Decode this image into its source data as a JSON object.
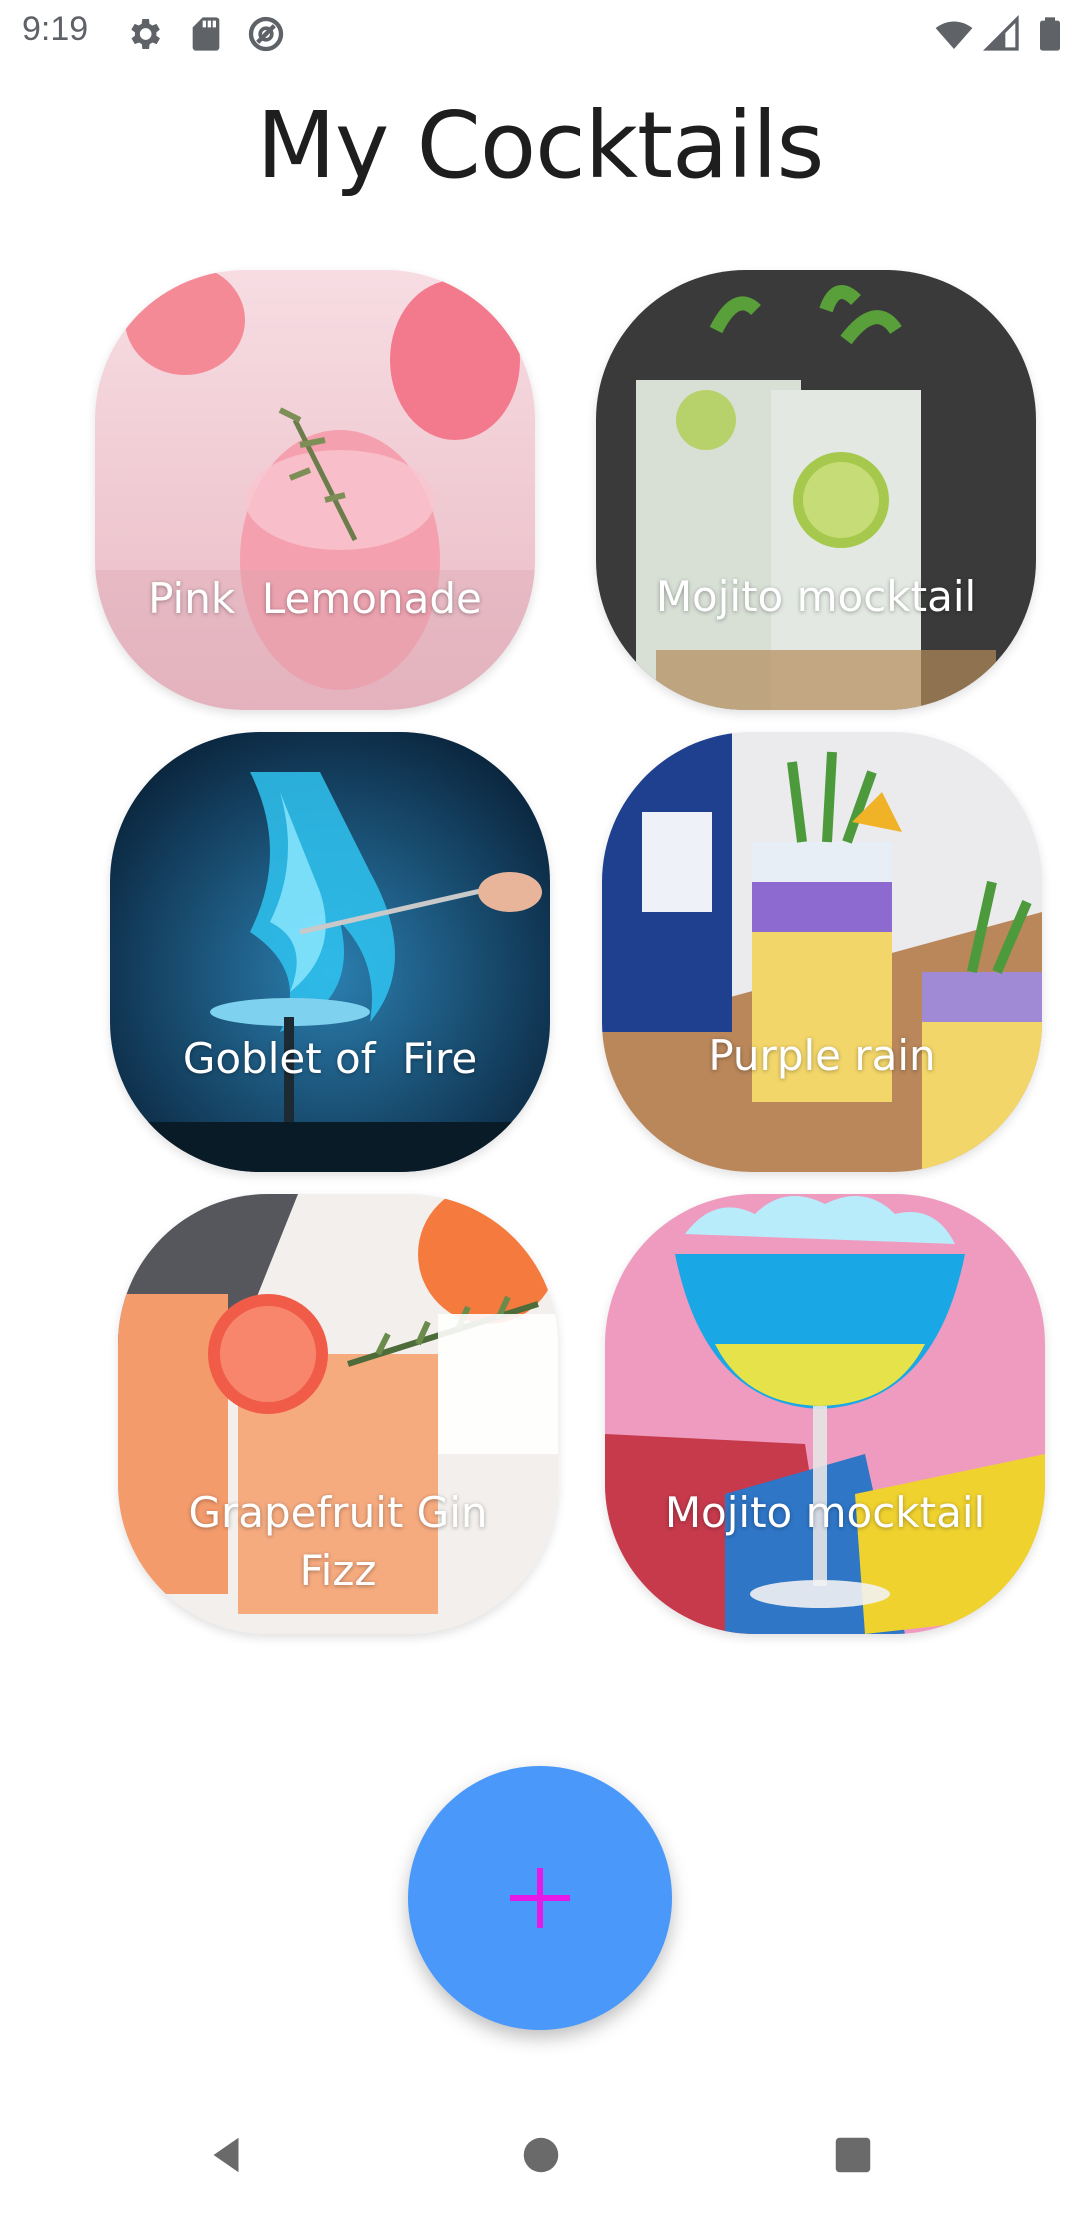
{
  "status_bar": {
    "time": "9:19",
    "icons": [
      "settings-icon",
      "sd-card-icon",
      "no-tracking-icon",
      "wifi-icon",
      "signal-icon",
      "battery-icon"
    ]
  },
  "header": {
    "title": "My Cocktails"
  },
  "cocktails": [
    {
      "label": "Pink  Lemonade",
      "theme": "pink"
    },
    {
      "label": "Mojito mocktail",
      "theme": "mojito"
    },
    {
      "label": "Goblet of  Fire",
      "theme": "fire"
    },
    {
      "label": "Purple rain",
      "theme": "purple"
    },
    {
      "label": "Grapefruit Gin\nFizz",
      "theme": "grapefruit"
    },
    {
      "label": "Mojito mocktail",
      "theme": "blue"
    }
  ],
  "fab": {
    "icon": "plus-icon",
    "color": "#4a98f9",
    "icon_color": "#e619e6"
  },
  "nav_bar": {
    "icons": [
      "back-icon",
      "home-icon",
      "recents-icon"
    ]
  }
}
